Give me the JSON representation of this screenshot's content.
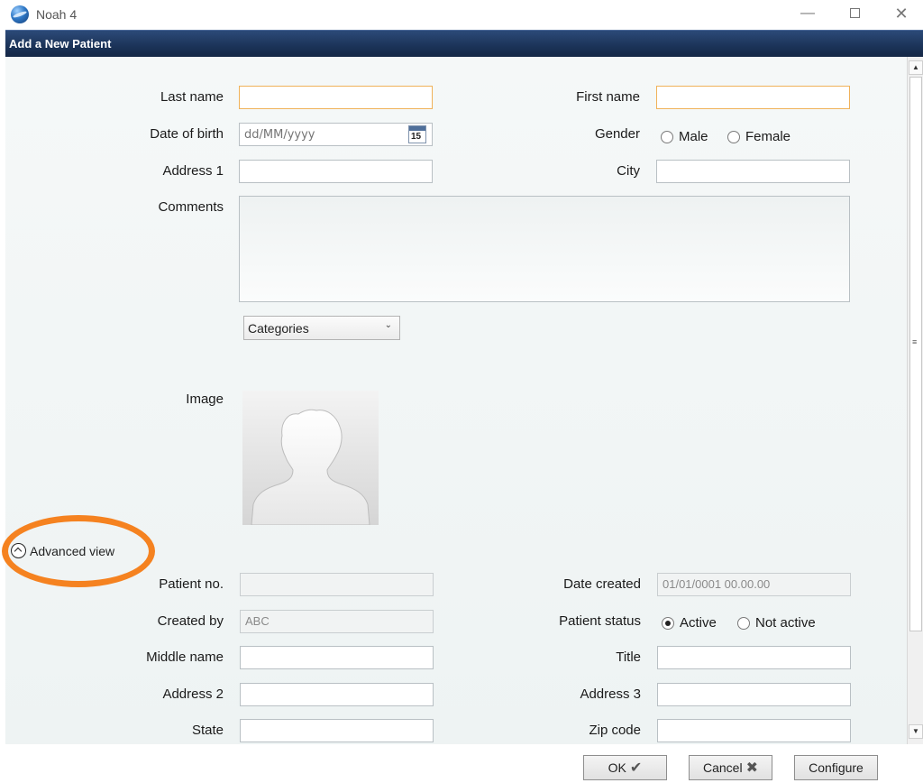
{
  "window": {
    "title": "Noah 4",
    "minimize_glyph": "—",
    "close_glyph": "✕"
  },
  "dialog": {
    "title": "Add a New Patient"
  },
  "form": {
    "last_name": {
      "label": "Last name",
      "value": ""
    },
    "first_name": {
      "label": "First name",
      "value": ""
    },
    "date_of_birth": {
      "label": "Date of birth",
      "placeholder": "dd/MM/yyyy",
      "calendar_day": "15"
    },
    "gender": {
      "label": "Gender",
      "options": [
        "Male",
        "Female"
      ],
      "selected": null
    },
    "address1": {
      "label": "Address 1",
      "value": ""
    },
    "city": {
      "label": "City",
      "value": ""
    },
    "comments": {
      "label": "Comments",
      "value": ""
    },
    "categories": {
      "label": "Categories"
    },
    "image": {
      "label": "Image"
    }
  },
  "advanced": {
    "toggle_label": "Advanced view",
    "highlight_color": "#f58220",
    "patient_no": {
      "label": "Patient no.",
      "value": ""
    },
    "date_created": {
      "label": "Date created",
      "value": "01/01/0001 00.00.00"
    },
    "created_by": {
      "label": "Created by",
      "value": "ABC"
    },
    "patient_status": {
      "label": "Patient status",
      "options": [
        "Active",
        "Not active"
      ],
      "selected": "Active"
    },
    "middle_name": {
      "label": "Middle name",
      "value": ""
    },
    "title": {
      "label": "Title",
      "value": ""
    },
    "address2": {
      "label": "Address 2",
      "value": ""
    },
    "address3": {
      "label": "Address 3",
      "value": ""
    },
    "state": {
      "label": "State",
      "value": ""
    },
    "zip_code": {
      "label": "Zip code",
      "value": ""
    }
  },
  "buttons": {
    "ok": "OK",
    "cancel": "Cancel",
    "configure": "Configure"
  },
  "colors": {
    "header": "#1b3358",
    "required_border": "#f0b25a"
  }
}
